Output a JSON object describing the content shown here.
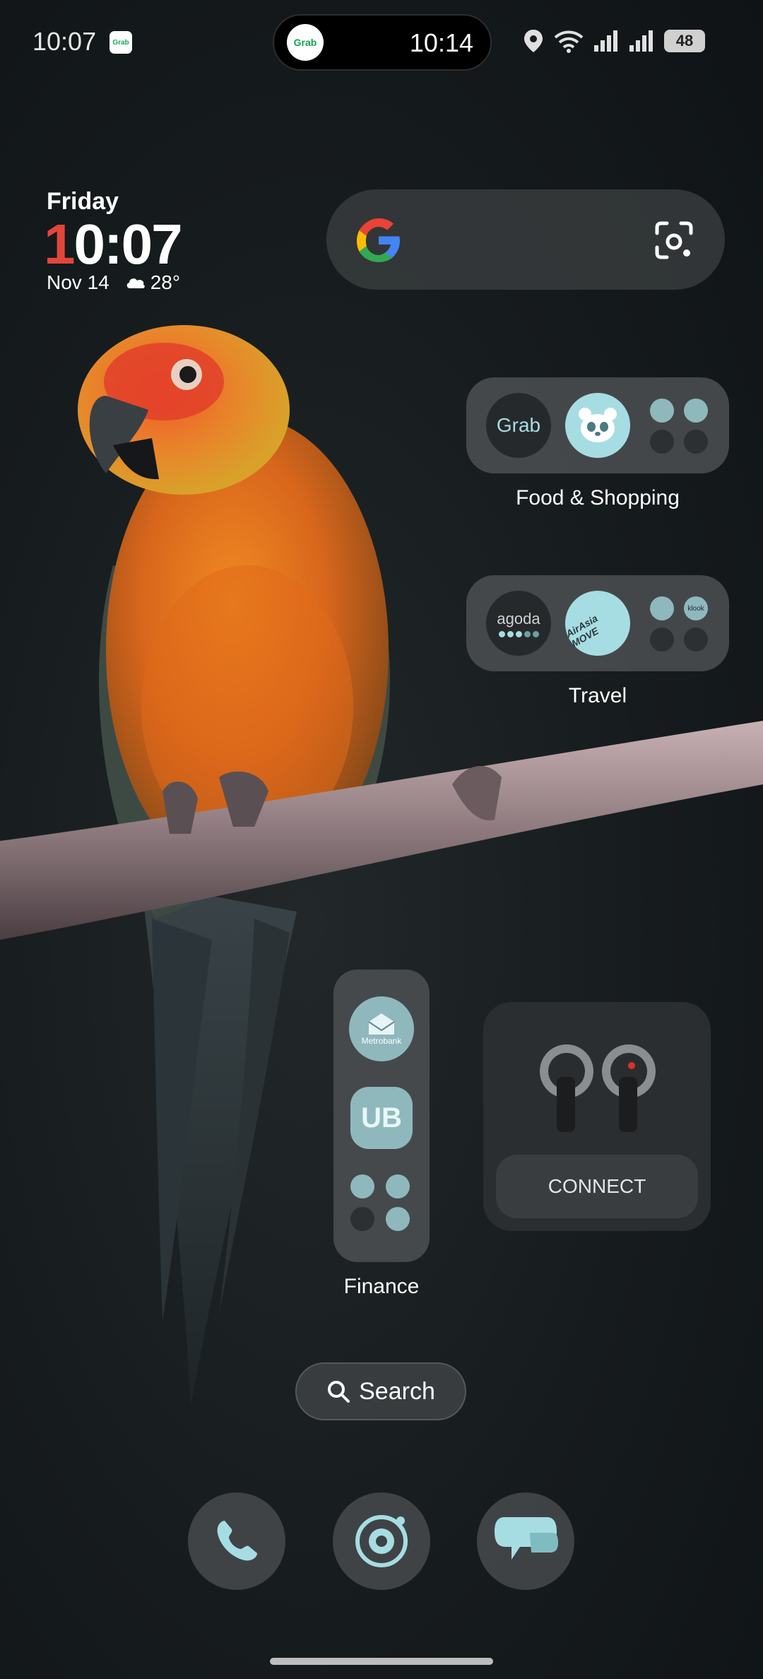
{
  "status_bar": {
    "time": "10:07",
    "notification_icon": "grab-notification-icon",
    "island_app": "Grab",
    "island_time": "10:14",
    "battery": "48"
  },
  "clock_widget": {
    "day": "Friday",
    "time_first_digit": "1",
    "time_rest": "0:07",
    "date": "Nov 14",
    "temperature": "28°"
  },
  "google_bar": {
    "logo": "google-logo",
    "lens": "google-lens-icon"
  },
  "folders": {
    "food_shopping": {
      "label": "Food & Shopping",
      "apps": [
        "Grab",
        "foodpanda"
      ]
    },
    "travel": {
      "label": "Travel",
      "apps": [
        "agoda",
        "AirAsia MOVE",
        "klook"
      ]
    },
    "finance": {
      "label": "Finance",
      "apps": [
        "Metrobank",
        "UB"
      ]
    }
  },
  "earbuds_widget": {
    "connect_label": "CONNECT"
  },
  "search_pill": {
    "label": "Search"
  },
  "dock": [
    "phone-icon",
    "camera-icon",
    "messages-icon"
  ],
  "colors": {
    "accent": "#a6dde3",
    "clock_red": "#e2463b",
    "background": "#161b1d"
  }
}
